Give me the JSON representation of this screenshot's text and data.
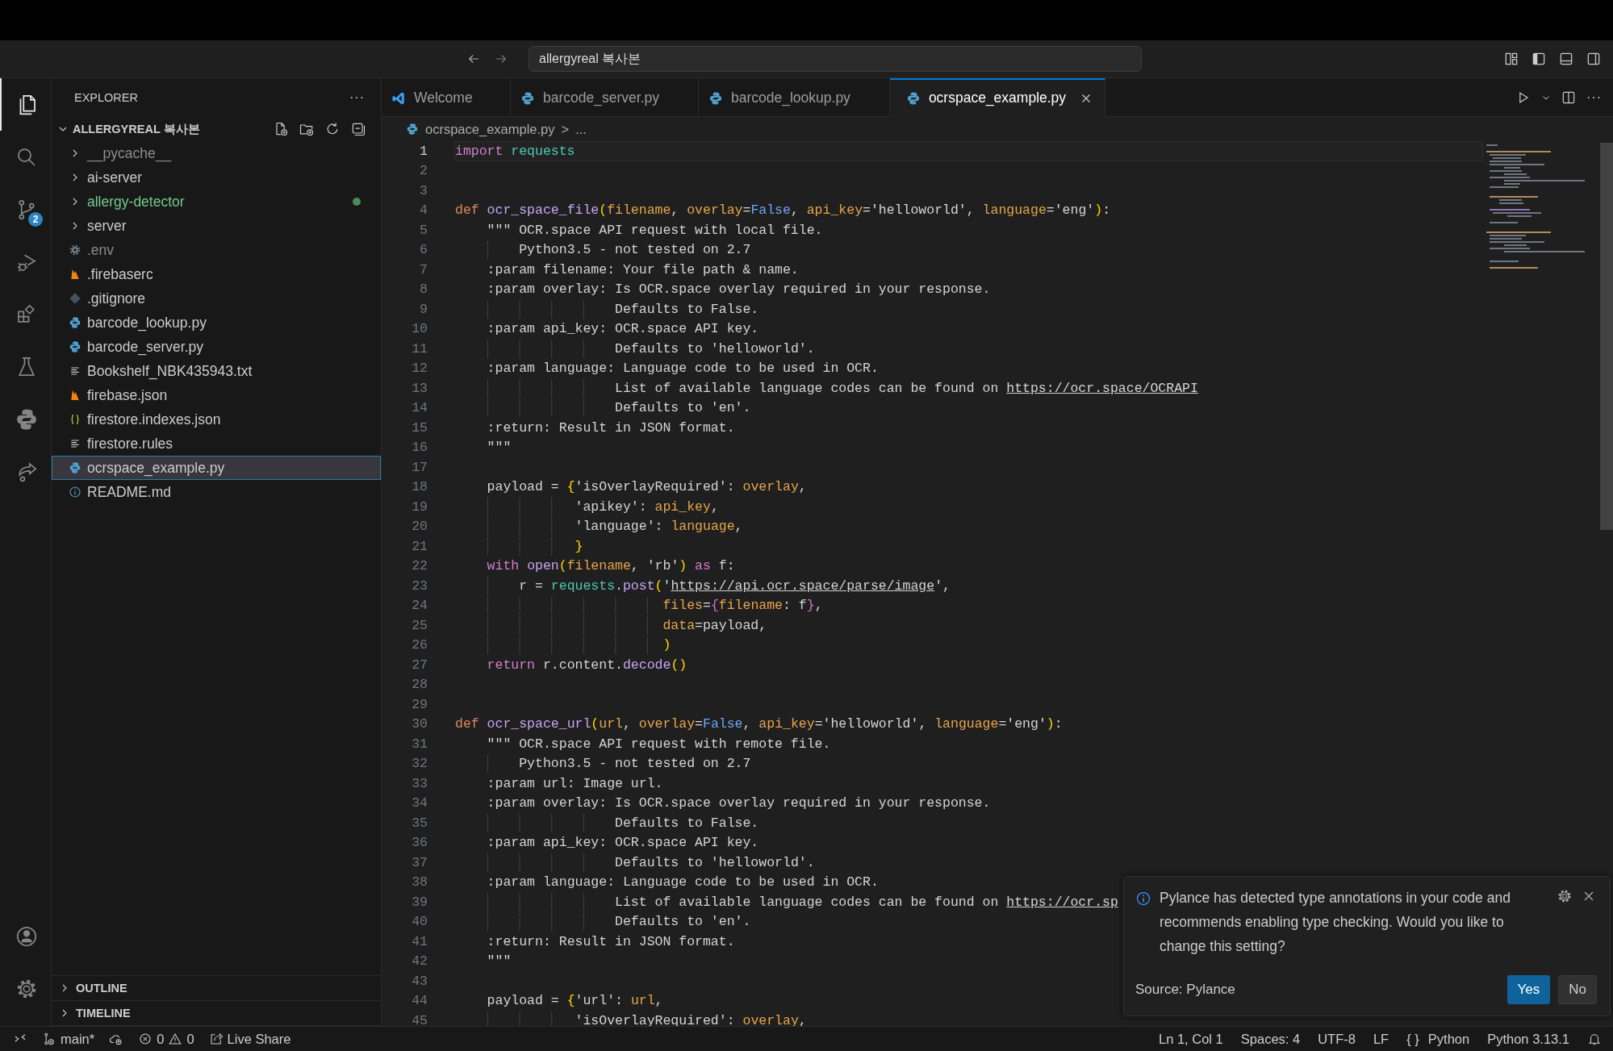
{
  "title_bar": {
    "search": "allergyreal 복사본"
  },
  "activity_bar": {
    "items": [
      {
        "kind": "explorer",
        "selected": true
      },
      {
        "kind": "search",
        "selected": false
      },
      {
        "kind": "source-control",
        "selected": false,
        "badge": "2"
      },
      {
        "kind": "run-debug",
        "selected": false
      },
      {
        "kind": "extensions",
        "selected": false
      },
      {
        "kind": "testing",
        "selected": false
      },
      {
        "kind": "python",
        "selected": false
      },
      {
        "kind": "remote",
        "selected": false
      }
    ],
    "bottom": [
      {
        "kind": "account"
      },
      {
        "kind": "settings"
      }
    ]
  },
  "sidebar": {
    "title": "EXPLORER",
    "more": "···",
    "root": {
      "label": "ALLERGYREAL 복사본",
      "expanded": true
    },
    "items": [
      {
        "label": "__pycache__",
        "kind": "folder",
        "expanded": false,
        "ignored": true,
        "untracked": false,
        "selected": false
      },
      {
        "label": "ai-server",
        "kind": "folder",
        "expanded": false,
        "ignored": false,
        "untracked": false,
        "selected": false
      },
      {
        "label": "allergy-detector",
        "kind": "folder",
        "expanded": false,
        "ignored": false,
        "untracked": true,
        "selected": false
      },
      {
        "label": "server",
        "kind": "folder",
        "expanded": false,
        "ignored": false,
        "untracked": false,
        "selected": false
      },
      {
        "label": ".env",
        "kind": "config",
        "ignored": true,
        "untracked": false,
        "selected": false
      },
      {
        "label": ".firebaserc",
        "kind": "firebase",
        "ignored": false,
        "untracked": false,
        "selected": false
      },
      {
        "label": ".gitignore",
        "kind": "git",
        "ignored": false,
        "untracked": false,
        "selected": false
      },
      {
        "label": "barcode_lookup.py",
        "kind": "python",
        "ignored": false,
        "untracked": false,
        "selected": false
      },
      {
        "label": "barcode_server.py",
        "kind": "python",
        "ignored": false,
        "untracked": false,
        "selected": false
      },
      {
        "label": "Bookshelf_NBK435943.txt",
        "kind": "text",
        "ignored": false,
        "untracked": false,
        "selected": false
      },
      {
        "label": "firebase.json",
        "kind": "firebase",
        "ignored": false,
        "untracked": false,
        "selected": false
      },
      {
        "label": "firestore.indexes.json",
        "kind": "json",
        "ignored": false,
        "untracked": false,
        "selected": false
      },
      {
        "label": "firestore.rules",
        "kind": "text",
        "ignored": false,
        "untracked": false,
        "selected": false
      },
      {
        "label": "ocrspace_example.py",
        "kind": "python",
        "ignored": false,
        "untracked": false,
        "selected": true
      },
      {
        "label": "README.md",
        "kind": "info",
        "ignored": false,
        "untracked": false,
        "selected": false
      }
    ],
    "sections": [
      {
        "label": "OUTLINE",
        "expanded": false
      },
      {
        "label": "TIMELINE",
        "expanded": false
      }
    ]
  },
  "tabs": [
    {
      "label": "Welcome",
      "kind": "welcome",
      "selected": false
    },
    {
      "label": "barcode_server.py",
      "kind": "python",
      "selected": false
    },
    {
      "label": "barcode_lookup.py",
      "kind": "python",
      "selected": false
    },
    {
      "label": "ocrspace_example.py",
      "kind": "python",
      "selected": true
    }
  ],
  "breadcrumb": {
    "file": "ocrspace_example.py",
    "separator": ">",
    "rest": "..."
  },
  "editor": {
    "lines": [
      {
        "number": "1",
        "current": true,
        "tokens": [
          {
            "text": "import ",
            "kind": "kw"
          },
          {
            "text": "requests",
            "kind": "mod"
          }
        ]
      },
      {
        "number": "2",
        "current": false
      },
      {
        "number": "3",
        "current": false
      },
      {
        "number": "4",
        "current": false,
        "tokens": [
          {
            "text": "def ",
            "kind": "defkw"
          },
          {
            "text": "ocr_space_file",
            "kind": "fn"
          },
          {
            "text": "(",
            "kind": "br1"
          },
          {
            "text": "filename",
            "kind": "param"
          },
          {
            "text": ", ",
            "kind": "plain"
          },
          {
            "text": "overlay",
            "kind": "param"
          },
          {
            "text": "=",
            "kind": "plain"
          },
          {
            "text": "False",
            "kind": "const"
          },
          {
            "text": ", ",
            "kind": "plain"
          },
          {
            "text": "api_key",
            "kind": "param"
          },
          {
            "text": "=",
            "kind": "plain"
          },
          {
            "text": "'helloworld'",
            "kind": "str"
          },
          {
            "text": ", ",
            "kind": "plain"
          },
          {
            "text": "language",
            "kind": "param"
          },
          {
            "text": "=",
            "kind": "plain"
          },
          {
            "text": "'eng'",
            "kind": "str"
          },
          {
            "text": ")",
            "kind": "br1"
          },
          {
            "text": ":",
            "kind": "plain"
          }
        ]
      },
      {
        "number": "5",
        "current": false,
        "tokens": [
          {
            "text": "    \"\"\" OCR.space API request with local file.",
            "kind": "doc"
          }
        ]
      },
      {
        "number": "6",
        "current": false,
        "tokens": [
          {
            "text": "        Python3.5 - not tested on 2.7",
            "kind": "doc"
          }
        ]
      },
      {
        "number": "7",
        "current": false,
        "tokens": [
          {
            "text": "    :param filename: Your file path & name.",
            "kind": "doc"
          }
        ]
      },
      {
        "number": "8",
        "current": false,
        "tokens": [
          {
            "text": "    :param overlay: Is OCR.space overlay required in your response.",
            "kind": "doc"
          }
        ]
      },
      {
        "number": "9",
        "current": false,
        "tokens": [
          {
            "text": "                    Defaults to False.",
            "kind": "doc"
          }
        ]
      },
      {
        "number": "10",
        "current": false,
        "tokens": [
          {
            "text": "    :param api_key: OCR.space API key.",
            "kind": "doc"
          }
        ]
      },
      {
        "number": "11",
        "current": false,
        "tokens": [
          {
            "text": "                    Defaults to 'helloworld'.",
            "kind": "doc"
          }
        ]
      },
      {
        "number": "12",
        "current": false,
        "tokens": [
          {
            "text": "    :param language: Language code to be used in OCR.",
            "kind": "doc"
          }
        ]
      },
      {
        "number": "13",
        "current": false,
        "tokens": [
          {
            "text": "                    List of available language codes can be found on ",
            "kind": "doc"
          },
          {
            "text": "https://ocr.space/OCRAPI",
            "kind": "link"
          }
        ]
      },
      {
        "number": "14",
        "current": false,
        "tokens": [
          {
            "text": "                    Defaults to 'en'.",
            "kind": "doc"
          }
        ]
      },
      {
        "number": "15",
        "current": false,
        "tokens": [
          {
            "text": "    :return: Result in JSON format.",
            "kind": "doc"
          }
        ]
      },
      {
        "number": "16",
        "current": false,
        "tokens": [
          {
            "text": "    \"\"\"",
            "kind": "doc"
          }
        ]
      },
      {
        "number": "17",
        "current": false
      },
      {
        "number": "18",
        "current": false,
        "tokens": [
          {
            "text": "    payload = ",
            "kind": "plain"
          },
          {
            "text": "{",
            "kind": "br1"
          },
          {
            "text": "'isOverlayRequired'",
            "kind": "str"
          },
          {
            "text": ": ",
            "kind": "plain"
          },
          {
            "text": "overlay",
            "kind": "param"
          },
          {
            "text": ",",
            "kind": "plain"
          }
        ]
      },
      {
        "number": "19",
        "current": false,
        "tokens": [
          {
            "text": "               'apikey'",
            "kind": "str"
          },
          {
            "text": ": ",
            "kind": "plain"
          },
          {
            "text": "api_key",
            "kind": "param"
          },
          {
            "text": ",",
            "kind": "plain"
          }
        ]
      },
      {
        "number": "20",
        "current": false,
        "tokens": [
          {
            "text": "               'language'",
            "kind": "str"
          },
          {
            "text": ": ",
            "kind": "plain"
          },
          {
            "text": "language",
            "kind": "param"
          },
          {
            "text": ",",
            "kind": "plain"
          }
        ]
      },
      {
        "number": "21",
        "current": false,
        "tokens": [
          {
            "text": "               }",
            "kind": "br1"
          }
        ]
      },
      {
        "number": "22",
        "current": false,
        "tokens": [
          {
            "text": "    with ",
            "kind": "kw"
          },
          {
            "text": "open",
            "kind": "fn"
          },
          {
            "text": "(",
            "kind": "br1"
          },
          {
            "text": "filename",
            "kind": "param"
          },
          {
            "text": ", ",
            "kind": "plain"
          },
          {
            "text": "'rb'",
            "kind": "str"
          },
          {
            "text": ")",
            "kind": "br1"
          },
          {
            "text": " as",
            "kind": "kw"
          },
          {
            "text": " f:",
            "kind": "plain"
          }
        ]
      },
      {
        "number": "23",
        "current": false,
        "tokens": [
          {
            "text": "        r = ",
            "kind": "plain"
          },
          {
            "text": "requests",
            "kind": "mod"
          },
          {
            "text": ".",
            "kind": "plain"
          },
          {
            "text": "post",
            "kind": "fn"
          },
          {
            "text": "(",
            "kind": "br1"
          },
          {
            "text": "'",
            "kind": "str"
          },
          {
            "text": "https://api.ocr.space/parse/image",
            "kind": "link"
          },
          {
            "text": "'",
            "kind": "str"
          },
          {
            "text": ",",
            "kind": "plain"
          }
        ]
      },
      {
        "number": "24",
        "current": false,
        "tokens": [
          {
            "text": "                          files",
            "kind": "param"
          },
          {
            "text": "=",
            "kind": "plain"
          },
          {
            "text": "{",
            "kind": "br2"
          },
          {
            "text": "filename",
            "kind": "param"
          },
          {
            "text": ": f",
            "kind": "plain"
          },
          {
            "text": "}",
            "kind": "br2"
          },
          {
            "text": ",",
            "kind": "plain"
          }
        ]
      },
      {
        "number": "25",
        "current": false,
        "tokens": [
          {
            "text": "                          data",
            "kind": "param"
          },
          {
            "text": "=payload,",
            "kind": "plain"
          }
        ]
      },
      {
        "number": "26",
        "current": false,
        "tokens": [
          {
            "text": "                          )",
            "kind": "br1"
          }
        ]
      },
      {
        "number": "27",
        "current": false,
        "tokens": [
          {
            "text": "    return",
            "kind": "kw"
          },
          {
            "text": " r.content.",
            "kind": "plain"
          },
          {
            "text": "decode",
            "kind": "fn"
          },
          {
            "text": "()",
            "kind": "br1"
          }
        ]
      },
      {
        "number": "28",
        "current": false
      },
      {
        "number": "29",
        "current": false
      },
      {
        "number": "30",
        "current": false,
        "tokens": [
          {
            "text": "def ",
            "kind": "defkw"
          },
          {
            "text": "ocr_space_url",
            "kind": "fn"
          },
          {
            "text": "(",
            "kind": "br1"
          },
          {
            "text": "url",
            "kind": "param"
          },
          {
            "text": ", ",
            "kind": "plain"
          },
          {
            "text": "overlay",
            "kind": "param"
          },
          {
            "text": "=",
            "kind": "plain"
          },
          {
            "text": "False",
            "kind": "const"
          },
          {
            "text": ", ",
            "kind": "plain"
          },
          {
            "text": "api_key",
            "kind": "param"
          },
          {
            "text": "=",
            "kind": "plain"
          },
          {
            "text": "'helloworld'",
            "kind": "str"
          },
          {
            "text": ", ",
            "kind": "plain"
          },
          {
            "text": "language",
            "kind": "param"
          },
          {
            "text": "=",
            "kind": "plain"
          },
          {
            "text": "'eng'",
            "kind": "str"
          },
          {
            "text": ")",
            "kind": "br1"
          },
          {
            "text": ":",
            "kind": "plain"
          }
        ]
      },
      {
        "number": "31",
        "current": false,
        "tokens": [
          {
            "text": "    \"\"\" OCR.space API request with remote file.",
            "kind": "doc"
          }
        ]
      },
      {
        "number": "32",
        "current": false,
        "tokens": [
          {
            "text": "        Python3.5 - not tested on 2.7",
            "kind": "doc"
          }
        ]
      },
      {
        "number": "33",
        "current": false,
        "tokens": [
          {
            "text": "    :param url: Image url.",
            "kind": "doc"
          }
        ]
      },
      {
        "number": "34",
        "current": false,
        "tokens": [
          {
            "text": "    :param overlay: Is OCR.space overlay required in your response.",
            "kind": "doc"
          }
        ]
      },
      {
        "number": "35",
        "current": false,
        "tokens": [
          {
            "text": "                    Defaults to False.",
            "kind": "doc"
          }
        ]
      },
      {
        "number": "36",
        "current": false,
        "tokens": [
          {
            "text": "    :param api_key: OCR.space API key.",
            "kind": "doc"
          }
        ]
      },
      {
        "number": "37",
        "current": false,
        "tokens": [
          {
            "text": "                    Defaults to 'helloworld'.",
            "kind": "doc"
          }
        ]
      },
      {
        "number": "38",
        "current": false,
        "tokens": [
          {
            "text": "    :param language: Language code to be used in OCR.",
            "kind": "doc"
          }
        ]
      },
      {
        "number": "39",
        "current": false,
        "tokens": [
          {
            "text": "                    List of available language codes can be found on ",
            "kind": "doc"
          },
          {
            "text": "https://ocr.sp",
            "kind": "link"
          }
        ]
      },
      {
        "number": "40",
        "current": false,
        "tokens": [
          {
            "text": "                    Defaults to 'en'.",
            "kind": "doc"
          }
        ]
      },
      {
        "number": "41",
        "current": false,
        "tokens": [
          {
            "text": "    :return: Result in JSON format.",
            "kind": "doc"
          }
        ]
      },
      {
        "number": "42",
        "current": false,
        "tokens": [
          {
            "text": "    \"\"\"",
            "kind": "doc"
          }
        ]
      },
      {
        "number": "43",
        "current": false
      },
      {
        "number": "44",
        "current": false,
        "tokens": [
          {
            "text": "    payload = ",
            "kind": "plain"
          },
          {
            "text": "{",
            "kind": "br1"
          },
          {
            "text": "'url'",
            "kind": "str"
          },
          {
            "text": ": ",
            "kind": "plain"
          },
          {
            "text": "url",
            "kind": "param"
          },
          {
            "text": ",",
            "kind": "plain"
          }
        ]
      },
      {
        "number": "45",
        "current": false,
        "tokens": [
          {
            "text": "               'isOverlayRequired'",
            "kind": "str"
          },
          {
            "text": ": ",
            "kind": "plain"
          },
          {
            "text": "overlay",
            "kind": "param"
          },
          {
            "text": ",",
            "kind": "plain"
          }
        ]
      }
    ]
  },
  "notification": {
    "message": "Pylance has detected type annotations in your code and recommends enabling type checking. Would you like to change this setting?",
    "source": "Source: Pylance",
    "buttons": [
      {
        "label": "Yes",
        "primary": true
      },
      {
        "label": "No",
        "primary": false
      }
    ]
  },
  "status_bar": {
    "branch": "main*",
    "errors": "0",
    "warnings": "0",
    "live_share": "Live Share",
    "position": "Ln 1, Col 1",
    "spaces": "Spaces: 4",
    "encoding": "UTF-8",
    "eol": "LF",
    "language_braces": "{ }",
    "language": "Python",
    "interpreter": "Python 3.13.1"
  }
}
